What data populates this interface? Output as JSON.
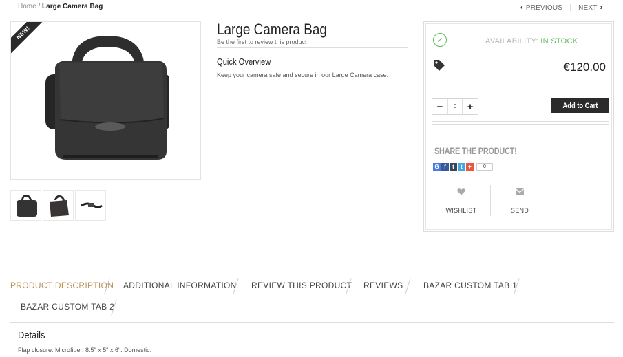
{
  "breadcrumb": {
    "home": "Home",
    "separator": " / ",
    "current": "Large Camera Bag"
  },
  "pager": {
    "previous": "PREVIOUS",
    "next": "NEXT"
  },
  "product": {
    "badge": "NEW!",
    "title": "Large Camera Bag",
    "review_link": "Be the first to review this product",
    "quick_overview_title": "Quick Overview",
    "quick_overview_text": "Keep your camera safe and secure in our Large Camera case."
  },
  "purchase": {
    "availability_label": "AVAILABILITY:",
    "availability_value": "IN STOCK",
    "price": "€120.00",
    "quantity": "0",
    "add_to_cart": "Add to Cart",
    "share_title": "SHARE THE PRODUCT!",
    "share_count": "0",
    "share_icons": [
      {
        "name": "google-icon",
        "glyph": "G",
        "color": "#4a7be0"
      },
      {
        "name": "facebook-icon",
        "glyph": "f",
        "color": "#3b5998"
      },
      {
        "name": "tumblr-icon",
        "glyph": "t",
        "color": "#35465c"
      },
      {
        "name": "twitter-icon",
        "glyph": "t",
        "color": "#42a6e0"
      },
      {
        "name": "plus-icon",
        "glyph": "+",
        "color": "#e9573f"
      }
    ],
    "wishlist": "WISHLIST",
    "send": "SEND"
  },
  "tabs": [
    {
      "label": "PRODUCT DESCRIPTION",
      "active": true
    },
    {
      "label": "ADDITIONAL INFORMATION",
      "active": false
    },
    {
      "label": "REVIEW THIS PRODUCT",
      "active": false
    },
    {
      "label": "REVIEWS",
      "active": false
    },
    {
      "label": "BAZAR CUSTOM TAB 1",
      "active": false
    },
    {
      "label": "BAZAR CUSTOM TAB 2",
      "active": false
    }
  ],
  "details": {
    "title": "Details",
    "text": "Flap closure. Microfiber. 8.5\" x 5\" x 6\". Domestic."
  },
  "colors": {
    "accent": "#b8965a",
    "stock": "#5cb85c",
    "button": "#2b2b2b"
  }
}
